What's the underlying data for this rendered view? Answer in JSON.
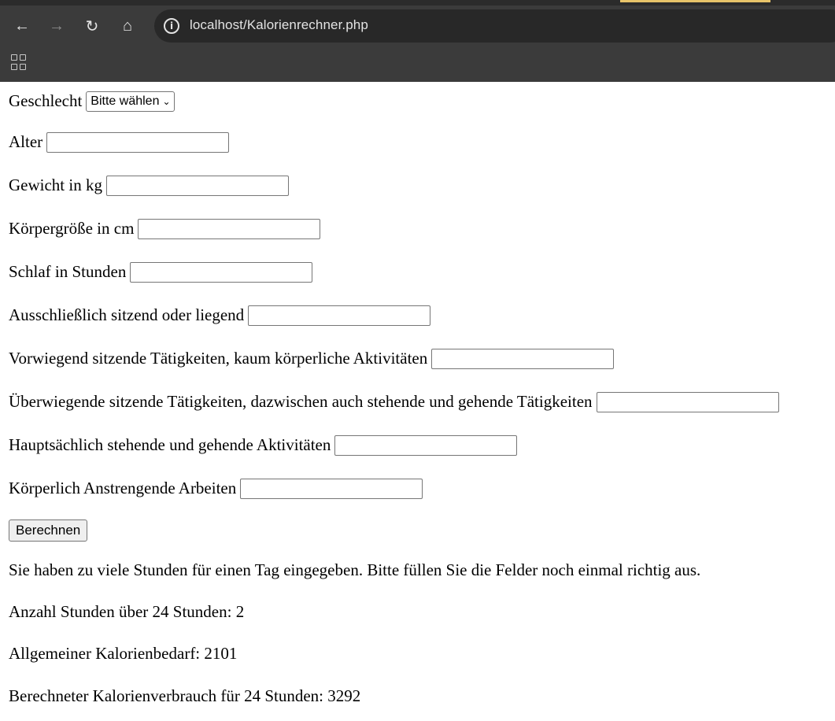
{
  "browser": {
    "url": "localhost/Kalorienrechner.php",
    "icons": [
      "back-icon",
      "forward-icon",
      "reload-icon",
      "home-icon",
      "info-icon",
      "apps-icon"
    ],
    "colors": {
      "toolbar": "#3b3b3b",
      "omnibox": "#282828",
      "tab_accent": "#e8c46a"
    }
  },
  "form": {
    "gender": {
      "label": "Geschlecht",
      "selected": "Bitte wählen"
    },
    "fields": [
      {
        "label": "Alter",
        "value": ""
      },
      {
        "label": "Gewicht in kg",
        "value": ""
      },
      {
        "label": "Körpergröße in cm",
        "value": ""
      },
      {
        "label": "Schlaf in Stunden",
        "value": ""
      },
      {
        "label": "Ausschließlich sitzend oder liegend",
        "value": ""
      },
      {
        "label": "Vorwiegend sitzende Tätigkeiten, kaum körperliche Aktivitäten",
        "value": ""
      },
      {
        "label": "Überwiegende sitzende Tätigkeiten, dazwischen auch stehende und gehende Tätigkeiten",
        "value": ""
      },
      {
        "label": "Hauptsächlich stehende und gehende Aktivitäten",
        "value": ""
      },
      {
        "label": "Körperlich Anstrengende Arbeiten",
        "value": ""
      }
    ],
    "submit_label": "Berechnen"
  },
  "results": {
    "error": "Sie haben zu viele Stunden für einen Tag eingegeben. Bitte füllen Sie die Felder noch einmal richtig aus.",
    "over_hours": "Anzahl Stunden über 24 Stunden: 2",
    "general_need": "Allgemeiner Kalorienbedarf: 2101",
    "calculated_usage": "Berechneter Kalorienverbrauch für 24 Stunden: 3292"
  }
}
